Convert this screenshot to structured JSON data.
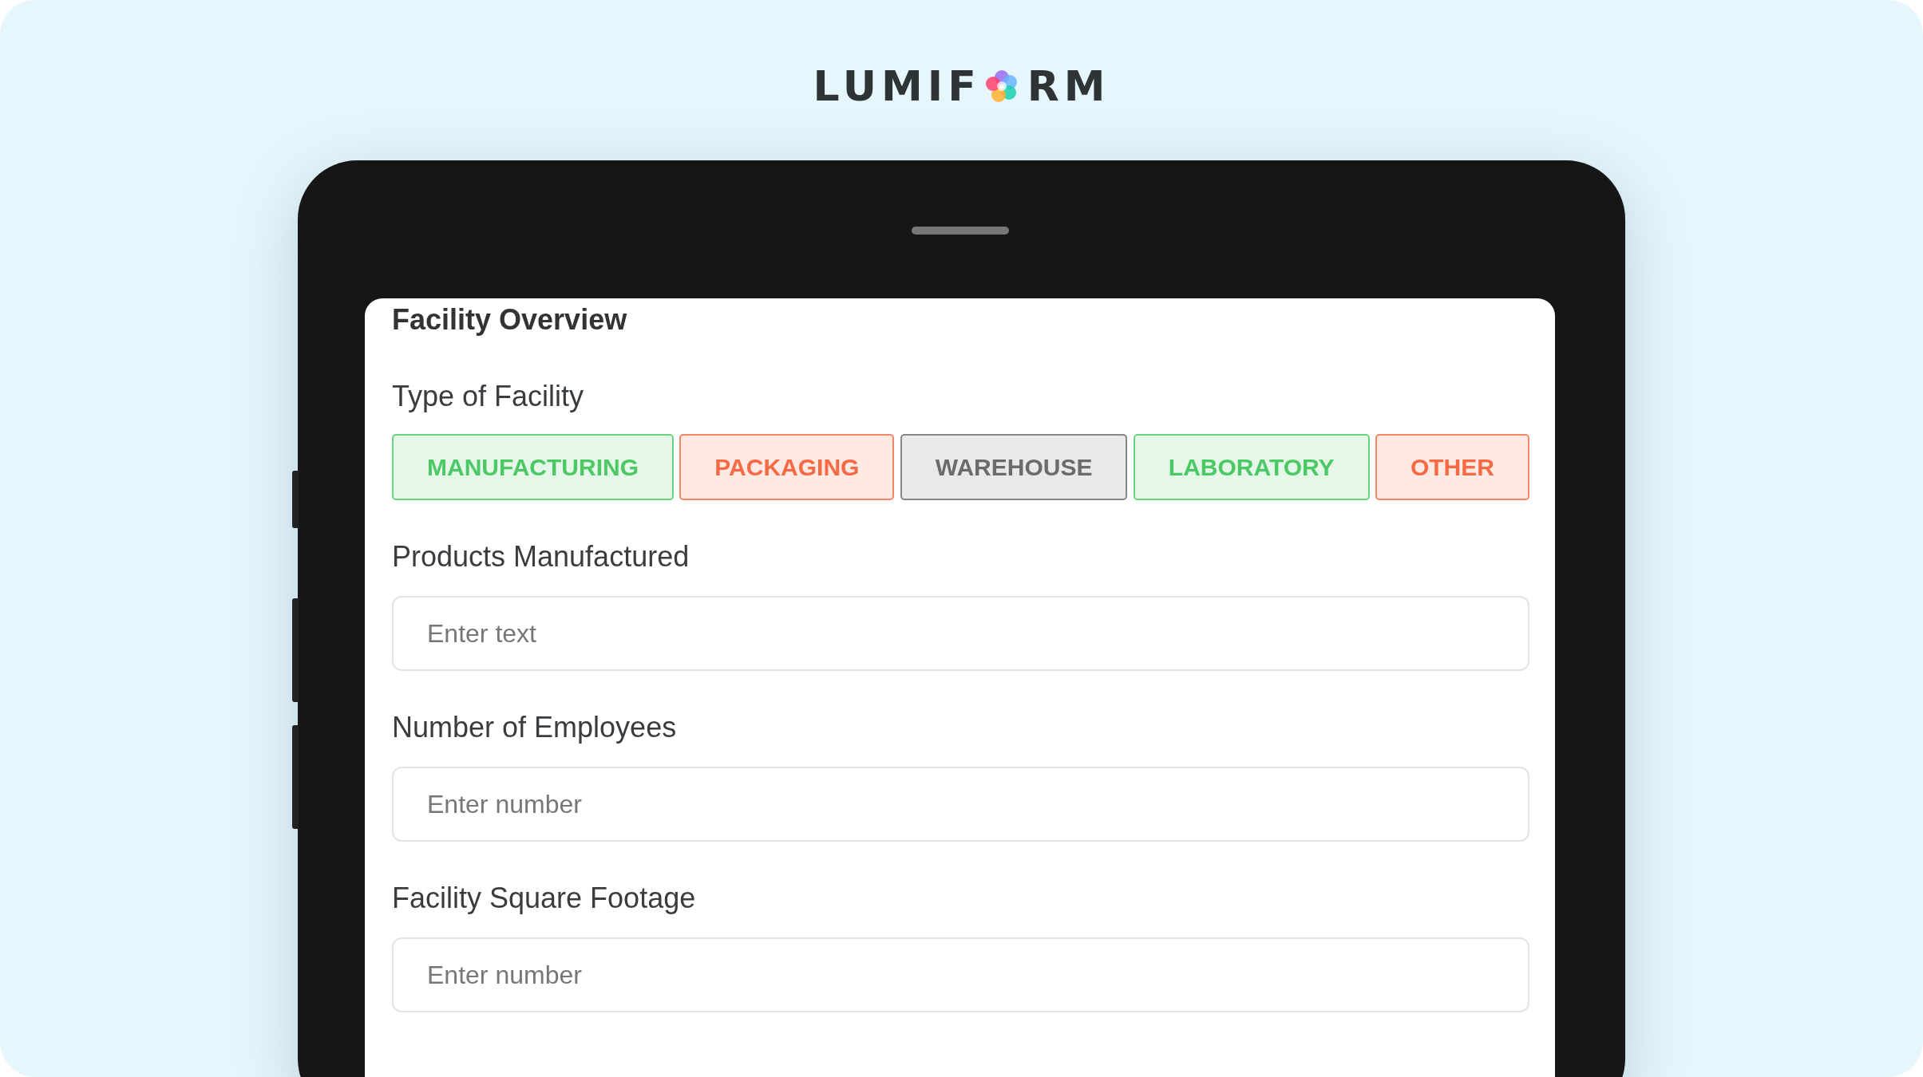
{
  "logo": {
    "text_before": "LUMIF",
    "text_after": "RM"
  },
  "form": {
    "title": "Facility Overview",
    "facility_type": {
      "label": "Type of Facility",
      "options": [
        {
          "label": "MANUFACTURING",
          "color": "#4cc865"
        },
        {
          "label": "PACKAGING",
          "color": "#f56a45"
        },
        {
          "label": "WAREHOUSE",
          "color": "#6b6b6b"
        },
        {
          "label": "LABORATORY",
          "color": "#4cc865"
        },
        {
          "label": "OTHER",
          "color": "#f56a45"
        }
      ]
    },
    "fields": [
      {
        "label": "Products Manufactured",
        "placeholder": "Enter text"
      },
      {
        "label": "Number of Employees",
        "placeholder": "Enter number"
      },
      {
        "label": "Facility Square Footage",
        "placeholder": "Enter number"
      }
    ]
  }
}
